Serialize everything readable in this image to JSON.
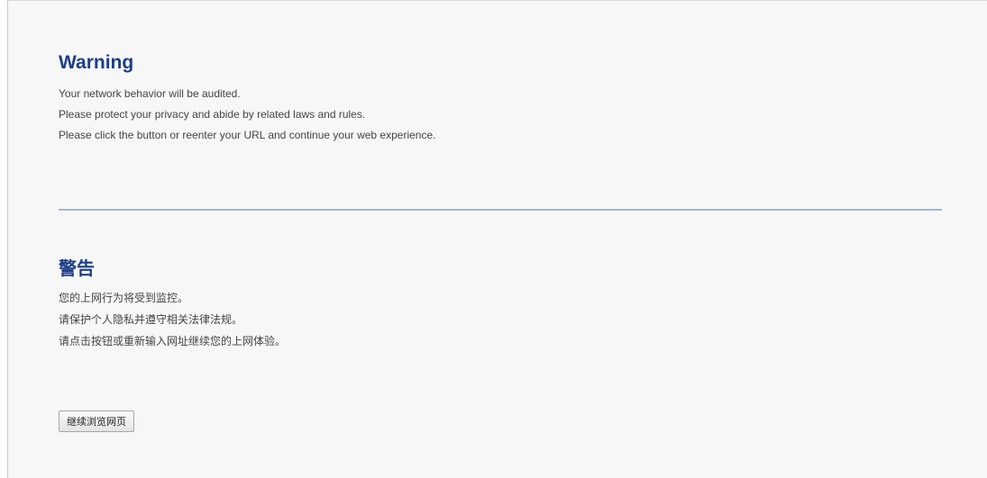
{
  "english": {
    "heading": "Warning",
    "lines": [
      "Your network behavior will be audited.",
      "Please protect your privacy and abide by related laws and rules.",
      "Please click the button or reenter your URL and continue your web experience."
    ]
  },
  "chinese": {
    "heading": "警告",
    "lines": [
      "您的上网行为将受到监控。",
      "请保护个人隐私并遵守相关法律法规。",
      "请点击按钮或重新输入网址继续您的上网体验。"
    ]
  },
  "continue_button": {
    "label": "继续浏览网页"
  },
  "colors": {
    "heading": "#1d3e87",
    "text": "#444444",
    "divider": "#aab6c8",
    "background": "#f7f7f7"
  }
}
